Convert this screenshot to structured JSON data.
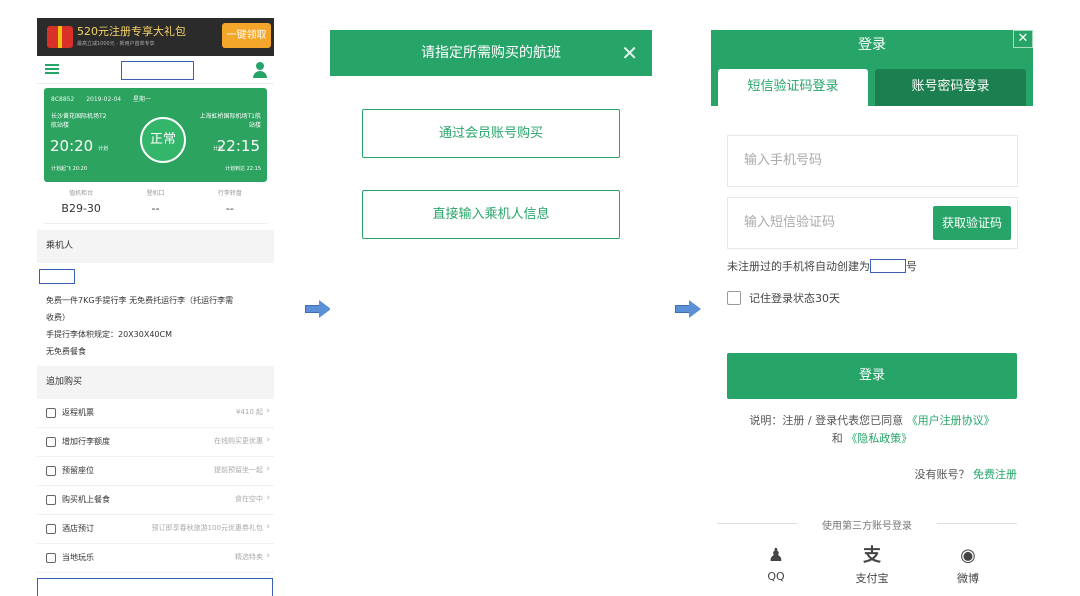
{
  "panel1": {
    "promo": {
      "title": "520元注册专享大礼包",
      "subtitle": "最高立减1000元 · 新用户首单专享",
      "button": "一键领取"
    },
    "ticket": {
      "flight_no": "8C8852",
      "date": "2019-02-04",
      "weekday": "星期一",
      "dep_airport": "长沙黄花国际机场T2航站楼",
      "arr_airport": "上海虹桥国际机场T1航站楼",
      "dep_time": "20:20",
      "arr_time": "22:15",
      "plan_label": "计划",
      "status": "正常",
      "dep_sub": "计划起飞 20:20",
      "arr_sub": "计划到达 22:15"
    },
    "gates": [
      {
        "label": "值机柜台",
        "value": "B29-30"
      },
      {
        "label": "登机口",
        "value": "--"
      },
      {
        "label": "行李转盘",
        "value": "--"
      }
    ],
    "passenger_title": "乘机人",
    "baggage_lines": [
      "免费一件7KG手提行李 无免费托运行李（托运行李需",
      "收费）",
      "手提行李体积规定：20X30X40CM",
      "无免费餐食"
    ],
    "addon_title": "追加购买",
    "addons": [
      {
        "icon": "plane-icon",
        "label": "返程机票",
        "note": "¥410 起"
      },
      {
        "icon": "luggage-icon",
        "label": "增加行李额度",
        "note": "在线购买更优惠"
      },
      {
        "icon": "seat-icon",
        "label": "预留座位",
        "note": "提前预留坐一起"
      },
      {
        "icon": "meal-icon",
        "label": "购买机上餐食",
        "note": "食在空中"
      },
      {
        "icon": "hotel-icon",
        "label": "酒店预订",
        "note": "预订即享春秋旅游100元优惠券礼包"
      },
      {
        "icon": "travel-icon",
        "label": "当地玩乐",
        "note": "精选特卖"
      }
    ]
  },
  "panel2": {
    "title": "请指定所需购买的航班",
    "close": "✕",
    "option1": "通过会员账号购买",
    "option2": "直接输入乘机人信息"
  },
  "panel3": {
    "title": "登录",
    "close": "✕",
    "tab_sms": "短信验证码登录",
    "tab_pwd": "账号密码登录",
    "phone_placeholder": "输入手机号码",
    "code_placeholder": "输入短信验证码",
    "get_code": "获取验证码",
    "auto_note_pre": "未注册过的手机将自动创建为",
    "auto_note_post": "号",
    "remember": "记住登录状态30天",
    "login": "登录",
    "terms_pre": "说明：注册 / 登录代表您已同意",
    "terms_link1": "《用户注册协议》",
    "terms_and": "和",
    "terms_link2": "《隐私政策》",
    "no_account": "没有账号？",
    "register": "免费注册",
    "third_title": "使用第三方账号登录",
    "third": [
      {
        "icon": "qq-icon",
        "glyph": "♟",
        "label": "QQ"
      },
      {
        "icon": "alipay-icon",
        "glyph": "支",
        "label": "支付宝"
      },
      {
        "icon": "weibo-icon",
        "glyph": "◉",
        "label": "微博"
      }
    ]
  },
  "colors": {
    "primary": "#27a569",
    "dark_tab": "#1c7f4f",
    "promo_bg": "#2b2b2b",
    "promo_btn": "#f4a62a",
    "arrow": "#5b8fd6"
  }
}
